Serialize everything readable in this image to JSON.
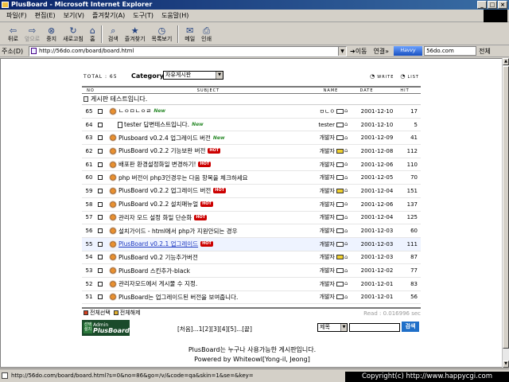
{
  "window": {
    "title": "PlusBoard - Microsoft Internet Explorer",
    "controls": [
      "_",
      "□",
      "×"
    ]
  },
  "menu": [
    "파일(F)",
    "편집(E)",
    "보기(V)",
    "즐겨찾기(A)",
    "도구(T)",
    "도움말(H)"
  ],
  "toolbar": {
    "back": "뒤로",
    "forward": "앞으로",
    "stop": "중지",
    "refresh": "새로고침",
    "home": "홈",
    "search": "검색",
    "favorites": "즐겨찾기",
    "history": "목록보기",
    "mail": "메일",
    "print": "인쇄"
  },
  "address": {
    "label": "주소(D)",
    "url": "http://56do.com/board/board.html",
    "go": "이동",
    "links": "연결",
    "havvy": "Havvy",
    "havvy_value": "56do.com",
    "all": "전체"
  },
  "board": {
    "total_label": "TOTAL : 65",
    "category_label": "Category",
    "category_value": "자유게시판",
    "write_label": "WRITE",
    "list_label": "LIST",
    "headers": {
      "no": "NO",
      "subject": "SUBJECT",
      "name": "NAME",
      "date": "DATE",
      "hit": "HIT"
    },
    "notice": "게시판 테스트입니다.",
    "rows": [
      {
        "no": "65",
        "subject": "ㄴㅇㅁㄴㅇㄹ",
        "badge": "new",
        "name": "ㅁㄴㅇ",
        "date": "2001-12-10",
        "hit": "17",
        "reply": false,
        "highlight": false,
        "mail_y": false
      },
      {
        "no": "64",
        "subject": "tester 답변테스트입니다.",
        "badge": "new",
        "name": "tester",
        "date": "2001-12-10",
        "hit": "5",
        "reply": true,
        "highlight": false,
        "mail_y": false
      },
      {
        "no": "63",
        "subject": "Plusboard v0.2.4 업그레이드 버전",
        "badge": "new",
        "name": "개발자",
        "date": "2001-12-09",
        "hit": "41",
        "reply": false,
        "highlight": false,
        "mail_y": false
      },
      {
        "no": "62",
        "subject": "PlusBoard v0.2.2 기능보완 버전",
        "badge": "hot",
        "name": "개발자",
        "date": "2001-12-08",
        "hit": "112",
        "reply": false,
        "highlight": false,
        "mail_y": true
      },
      {
        "no": "61",
        "subject": "배포판 환경설정화일 변경하기!",
        "badge": "hot",
        "name": "개발자",
        "date": "2001-12-06",
        "hit": "110",
        "reply": false,
        "highlight": false,
        "mail_y": false
      },
      {
        "no": "60",
        "subject": "php 버전이 php3인경우는 다음 항목을 체크하세요",
        "badge": "",
        "name": "개발자",
        "date": "2001-12-05",
        "hit": "70",
        "reply": false,
        "highlight": false,
        "mail_y": false
      },
      {
        "no": "59",
        "subject": "PlusBoard v0.2.2 업그레이드 버전",
        "badge": "hot",
        "name": "개발자",
        "date": "2001-12-04",
        "hit": "151",
        "reply": false,
        "highlight": false,
        "mail_y": true
      },
      {
        "no": "58",
        "subject": "PlusBoard v0.2.2 설치매뉴얼",
        "badge": "hot",
        "name": "개발자",
        "date": "2001-12-06",
        "hit": "137",
        "reply": false,
        "highlight": false,
        "mail_y": false
      },
      {
        "no": "57",
        "subject": "관리자 모드 설정 화일 단순화",
        "badge": "hot",
        "name": "개발자",
        "date": "2001-12-04",
        "hit": "125",
        "reply": false,
        "highlight": false,
        "mail_y": false
      },
      {
        "no": "56",
        "subject": "설치가이드 - html에서 php가 지원안되는 경우",
        "badge": "",
        "name": "개발자",
        "date": "2001-12-03",
        "hit": "60",
        "reply": false,
        "highlight": false,
        "mail_y": false
      },
      {
        "no": "55",
        "subject": "PlusBoard v0.2.1 업그레이드",
        "badge": "hot",
        "name": "개발자",
        "date": "2001-12-03",
        "hit": "111",
        "reply": false,
        "highlight": true,
        "mail_y": false
      },
      {
        "no": "54",
        "subject": "PlusBoard v0.2 기능추가버전",
        "badge": "",
        "name": "개발자",
        "date": "2001-12-03",
        "hit": "87",
        "reply": false,
        "highlight": false,
        "mail_y": true
      },
      {
        "no": "53",
        "subject": "PlusBoard 스킨추가-black",
        "badge": "",
        "name": "개발자",
        "date": "2001-12-02",
        "hit": "77",
        "reply": false,
        "highlight": false,
        "mail_y": false
      },
      {
        "no": "52",
        "subject": "관리자모드에서 게시물 수 지정.",
        "badge": "",
        "name": "개발자",
        "date": "2001-12-01",
        "hit": "83",
        "reply": false,
        "highlight": false,
        "mail_y": false
      },
      {
        "no": "51",
        "subject": "PlusBoard는 업그레이드된 버전을 보여줍니다.",
        "badge": "",
        "name": "개발자",
        "date": "2001-12-01",
        "hit": "56",
        "reply": false,
        "highlight": false,
        "mail_y": false
      }
    ],
    "select_all": "전체선택",
    "deselect_all": "전체해제",
    "read_time": "Read : 0.016996 sec",
    "pager": "[처음]...1[2][3][4][5]...[끝]",
    "search_field": "제목",
    "search_button": "검색",
    "admin_small": "Admin",
    "admin_logo_text": "PlusBoard",
    "admin_skin": "선택 설치"
  },
  "credits": {
    "line1": "PlusBoard는 누구나 사용가능한 게시판입니다.",
    "line2": "Powered by Whiteowl[Yong-il, Jeong]"
  },
  "status": {
    "url": "http://56do.com/board/board.html?s=0&no=86&go=/v/&code=qa&skin=1&se=&key=",
    "copyright": "Copyright(c) http://www.happycgi.com"
  }
}
